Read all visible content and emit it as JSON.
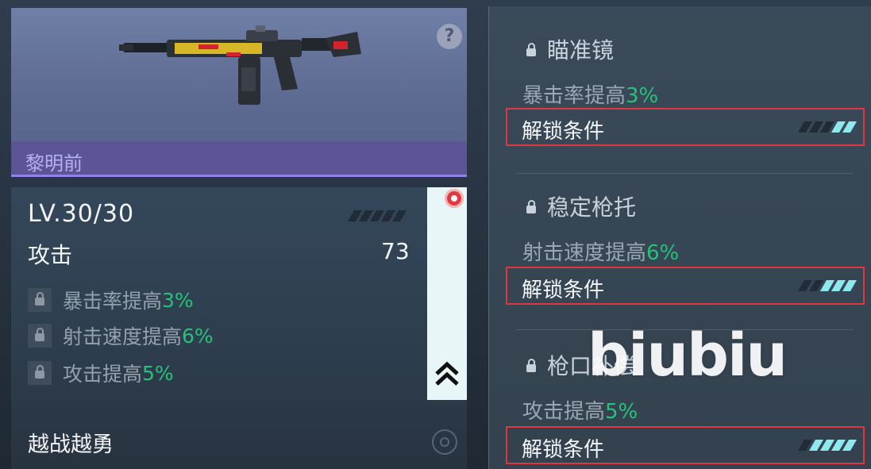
{
  "weapon_card": {
    "name": "黎明前",
    "help_label": "?",
    "level": "LV.30/30",
    "attack_label": "攻击",
    "attack_value": "73",
    "attributes": [
      {
        "text": "暴击率提高",
        "pct": "3%"
      },
      {
        "text": "射击速度提高",
        "pct": "6%"
      },
      {
        "text": "攻击提高",
        "pct": "5%"
      }
    ],
    "skill": "越战越勇"
  },
  "mods": [
    {
      "title": "瞄准镜",
      "desc": "暴击率提高",
      "pct": "3%",
      "unlock_label": "解锁条件",
      "unlock_progress": 0.4
    },
    {
      "title": "稳定枪托",
      "desc": "射击速度提高",
      "pct": "6%",
      "unlock_label": "解锁条件",
      "unlock_progress": 0.6
    },
    {
      "title": "枪口补偿",
      "desc": "攻击提高",
      "pct": "5%",
      "unlock_label": "解锁条件",
      "unlock_progress": 0.8
    }
  ],
  "watermark": "biubiu",
  "colors": {
    "accent_green": "#27c27a",
    "highlight_red": "#e0373d",
    "rarity_purple": "#8f82e8"
  }
}
